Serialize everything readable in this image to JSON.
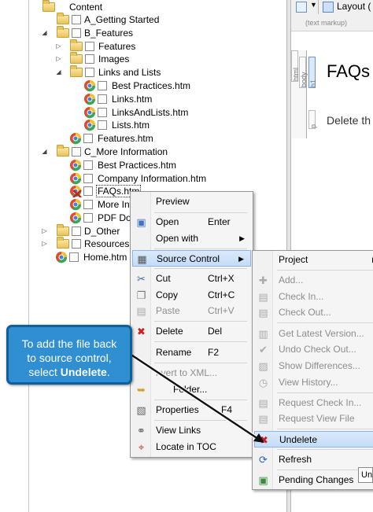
{
  "tree": {
    "items": [
      {
        "label": "Content",
        "kind": "folder",
        "expander": "open"
      },
      {
        "label": "A_Getting Started",
        "kind": "folder",
        "expander": ""
      },
      {
        "label": "B_Features",
        "kind": "folder",
        "expander": "open"
      },
      {
        "label": "Features",
        "kind": "folder",
        "expander": "closed"
      },
      {
        "label": "Images",
        "kind": "folder",
        "expander": "closed"
      },
      {
        "label": "Links and Lists",
        "kind": "folder",
        "expander": "open"
      },
      {
        "label": "Best Practices.htm",
        "kind": "file",
        "expander": ""
      },
      {
        "label": "Links.htm",
        "kind": "file",
        "expander": ""
      },
      {
        "label": "LinksAndLists.htm",
        "kind": "file",
        "expander": ""
      },
      {
        "label": "Lists.htm",
        "kind": "file",
        "expander": ""
      },
      {
        "label": "Features.htm",
        "kind": "file",
        "expander": ""
      },
      {
        "label": "C_More Information",
        "kind": "folder",
        "expander": "open"
      },
      {
        "label": "Best Practices.htm",
        "kind": "file",
        "expander": ""
      },
      {
        "label": "Company Information.htm",
        "kind": "file",
        "expander": ""
      },
      {
        "label": "FAQs.htm",
        "kind": "file-deleted",
        "expander": ""
      },
      {
        "label": "More Inf",
        "kind": "file",
        "expander": ""
      },
      {
        "label": "PDF Dov",
        "kind": "file",
        "expander": ""
      },
      {
        "label": "D_Other",
        "kind": "folder",
        "expander": "closed"
      },
      {
        "label": "Resources",
        "kind": "folder",
        "expander": "closed"
      },
      {
        "label": "Home.htm",
        "kind": "file",
        "expander": ""
      }
    ]
  },
  "editor": {
    "layout_label": "Layout (",
    "hint": "(text markup)",
    "tag_html": "html",
    "tag_body": "body",
    "tag_h1": "h1",
    "tag_p": "p",
    "heading": "FAQs",
    "paragraph": "Delete th"
  },
  "menu": {
    "items": [
      {
        "label": "Preview",
        "shortcut": "",
        "icon": "",
        "disabled": false,
        "submenu": false
      },
      {
        "label": "Open",
        "shortcut": "Enter",
        "icon": "open-icon",
        "disabled": false,
        "submenu": false
      },
      {
        "label": "Open with",
        "shortcut": "",
        "icon": "",
        "disabled": false,
        "submenu": true
      },
      {
        "label": "Source Control",
        "shortcut": "",
        "icon": "source-control-icon",
        "disabled": false,
        "submenu": true
      },
      {
        "label": "Cut",
        "shortcut": "Ctrl+X",
        "icon": "cut-icon",
        "disabled": false,
        "submenu": false
      },
      {
        "label": "Copy",
        "shortcut": "Ctrl+C",
        "icon": "copy-icon",
        "disabled": false,
        "submenu": false
      },
      {
        "label": "Paste",
        "shortcut": "Ctrl+V",
        "icon": "paste-icon",
        "disabled": true,
        "submenu": false
      },
      {
        "label": "Delete",
        "shortcut": "Del",
        "icon": "delete-icon",
        "disabled": false,
        "submenu": false
      },
      {
        "label": "Rename",
        "shortcut": "F2",
        "icon": "",
        "disabled": false,
        "submenu": false
      },
      {
        "label": "nvert to XML...",
        "shortcut": "",
        "icon": "",
        "disabled": true,
        "submenu": false
      },
      {
        "label": "Folder...",
        "shortcut": "",
        "icon": "send-icon",
        "disabled": false,
        "submenu": false
      },
      {
        "label": "Properties",
        "shortcut": "F4",
        "icon": "properties-icon",
        "disabled": false,
        "submenu": false
      },
      {
        "label": "View Links",
        "shortcut": "",
        "icon": "view-links-icon",
        "disabled": false,
        "submenu": false
      },
      {
        "label": "Locate in TOC",
        "shortcut": "",
        "icon": "locate-icon",
        "disabled": false,
        "submenu": false
      }
    ]
  },
  "submenu": {
    "items": [
      {
        "label": "Project",
        "disabled": false,
        "arrow": true
      },
      {
        "label": "Add...",
        "disabled": true
      },
      {
        "label": "Check In...",
        "disabled": true
      },
      {
        "label": "Check Out...",
        "disabled": true
      },
      {
        "label": "Get Latest Version...",
        "disabled": true
      },
      {
        "label": "Undo Check Out...",
        "disabled": true
      },
      {
        "label": "Show Differences...",
        "disabled": true
      },
      {
        "label": "View History...",
        "disabled": true
      },
      {
        "label": "Request Check In...",
        "disabled": true
      },
      {
        "label": "Request View File",
        "disabled": true
      },
      {
        "label": "Undelete",
        "disabled": false
      },
      {
        "label": "Refresh",
        "disabled": false
      },
      {
        "label": "Pending Changes",
        "disabled": false
      }
    ],
    "tooltip": "Un"
  },
  "callout": {
    "line1": "To add the file back",
    "line2": "to source control,",
    "line3_prefix": "select ",
    "line3_bold": "Undelete",
    "line3_suffix": "."
  },
  "colors": {
    "callout_bg": "#2f8fd0",
    "menu_highlight": "#c4dcf7",
    "delete_red": "#cc1f1f"
  }
}
